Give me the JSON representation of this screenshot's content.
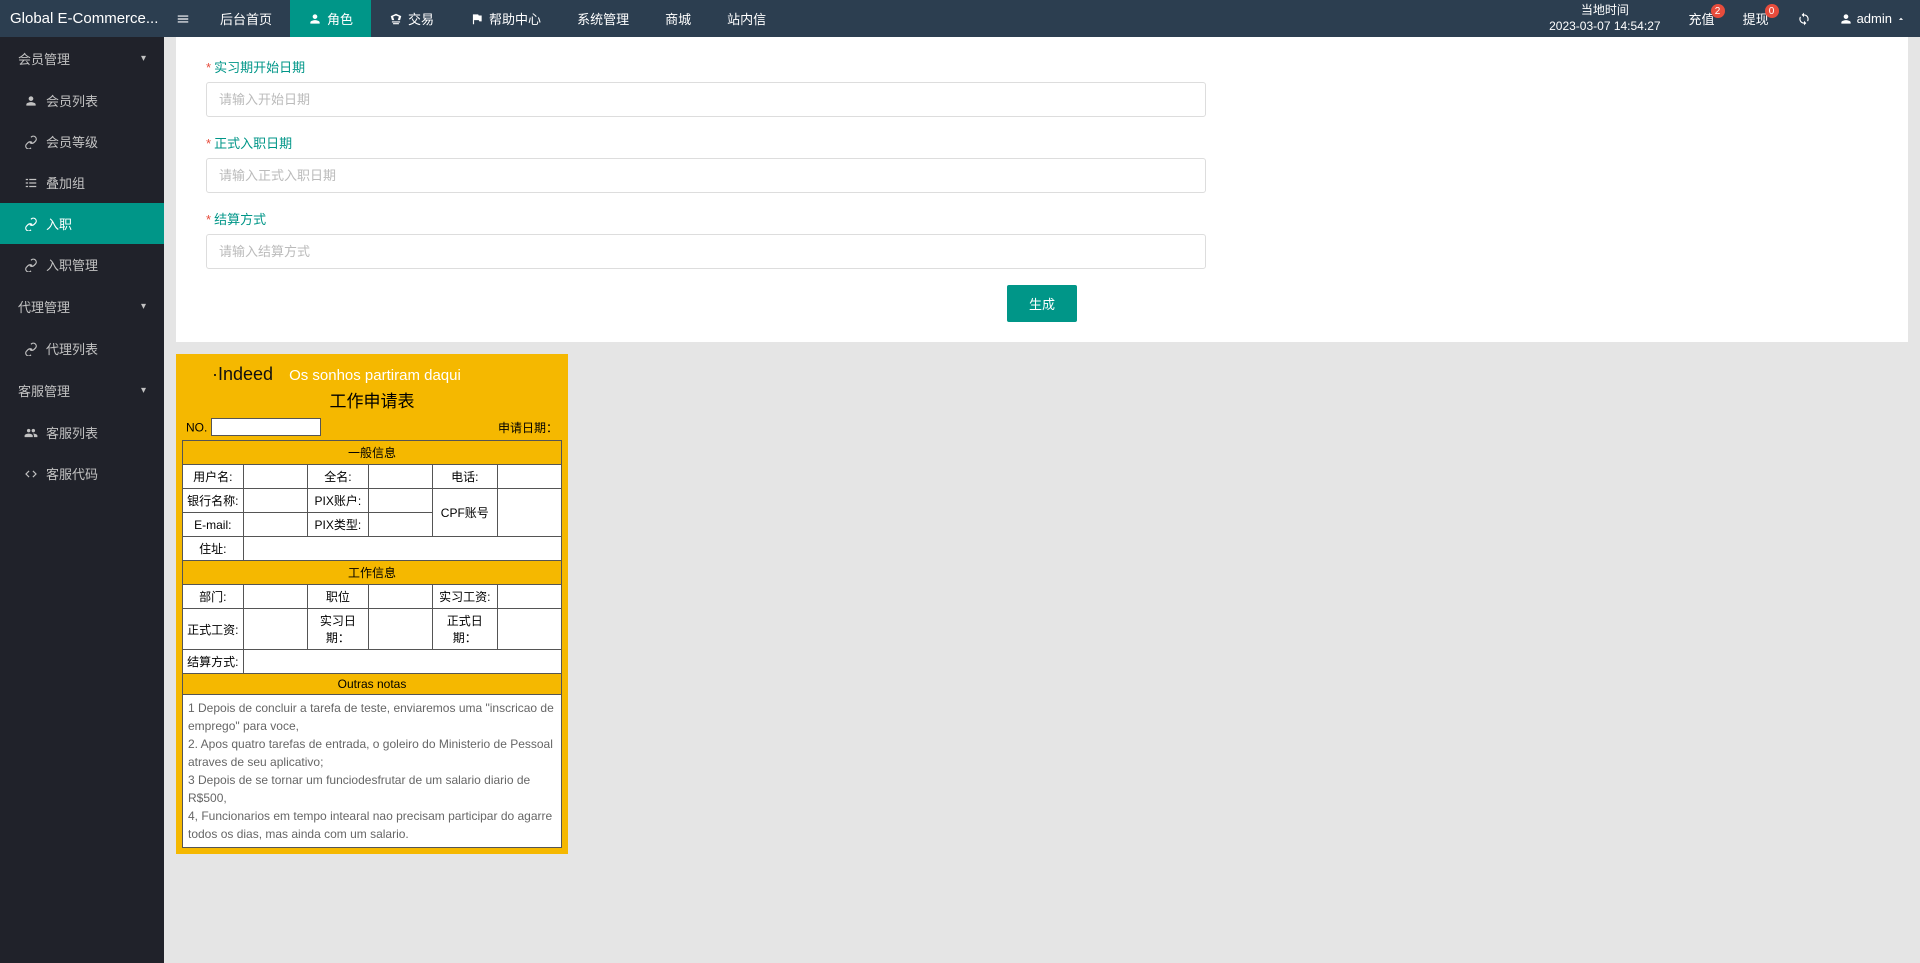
{
  "brand": "Global E-Commerce...",
  "nav": {
    "home": "后台首页",
    "role": "角色",
    "trade": "交易",
    "help": "帮助中心",
    "system": "系统管理",
    "mall": "商城",
    "mail": "站内信"
  },
  "clock": {
    "label": "当地时间",
    "value": "2023-03-07 14:54:27"
  },
  "right": {
    "recharge": "充值",
    "recharge_badge": "2",
    "withdraw": "提现",
    "withdraw_badge": "0",
    "user": "admin"
  },
  "sidebar": {
    "g_member": "会员管理",
    "member_list": "会员列表",
    "member_level": "会员等级",
    "stack_group": "叠加组",
    "onboard": "入职",
    "onboard_mgmt": "入职管理",
    "g_agent": "代理管理",
    "agent_list": "代理列表",
    "g_cs": "客服管理",
    "cs_list": "客服列表",
    "cs_code": "客服代码"
  },
  "form": {
    "f1_label": "实习期开始日期",
    "f1_ph": "请输入开始日期",
    "f2_label": "正式入职日期",
    "f2_ph": "请输入正式入职日期",
    "f3_label": "结算方式",
    "f3_ph": "请输入结算方式",
    "submit": "生成"
  },
  "doc": {
    "logo": "·Indeed",
    "slogan": "Os sonhos partiram daqui",
    "title": "工作申请表",
    "no_label": "NO.",
    "date_label": "申请日期：",
    "sec1": "一般信息",
    "r1c1": "用户名:",
    "r1c2": "全名:",
    "r1c3": "电话:",
    "r2c1": "银行名称:",
    "r2c2": "PIX账户:",
    "r23c3": "CPF账号",
    "r3c1": "E-mail:",
    "r3c2": "PIX类型:",
    "r4c1": "住址:",
    "sec2": "工作信息",
    "w1c1": "部门:",
    "w1c2": "职位",
    "w1c3": "实习工资:",
    "w2c1": "正式工资:",
    "w2c2": "实习日期：",
    "w2c3": "正式日期：",
    "w3c1": "结算方式:",
    "sec3": "Outras notas",
    "n1": "1 Depois de concluir a tarefa de teste, enviaremos uma \"inscricao de emprego\" para voce,",
    "n2": "2. Apos quatro tarefas de entrada, o goleiro do Ministerio de Pessoal atraves de seu aplicativo;",
    "n3": "3 Depois de se tornar um funciodesfrutar de um salario diario de R$500,",
    "n4": "4, Funcionarios em tempo intearal nao precisam participar do agarre todos os dias, mas ainda com um salario."
  }
}
